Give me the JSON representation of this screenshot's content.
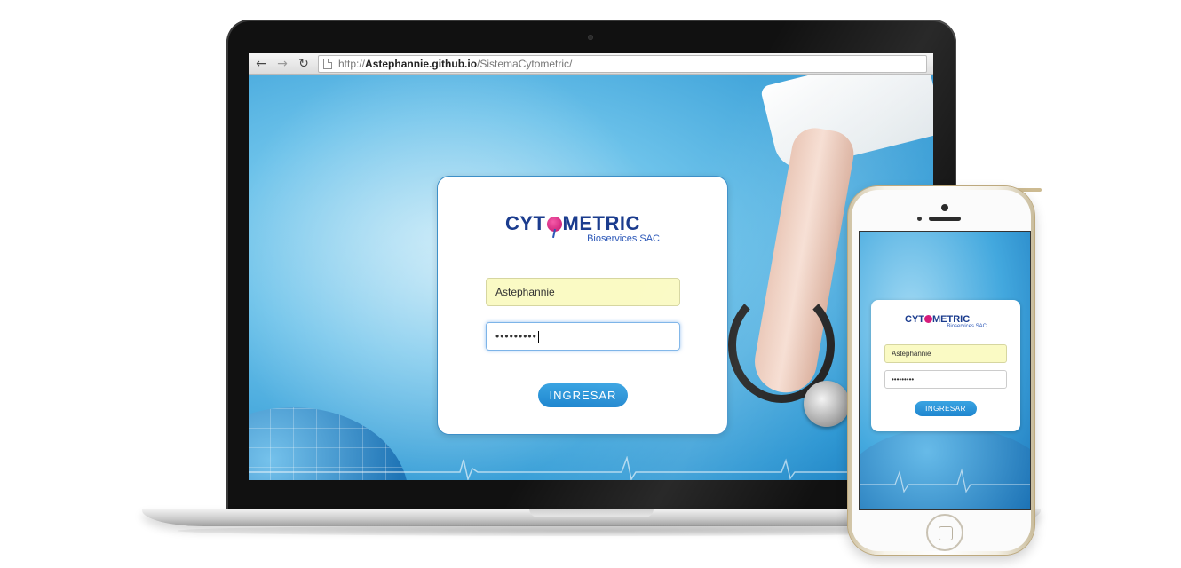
{
  "browser": {
    "back_icon": "←",
    "forward_icon": "→",
    "reload_icon": "↻",
    "url_prefix": "http://",
    "url_host": "Astephannie.github.io",
    "url_path": "/SistemaCytometric/"
  },
  "logo": {
    "main_before": "CYT",
    "main_after": "METRIC",
    "sub": "Bioservices SAC"
  },
  "login": {
    "username_value": "Astephannie",
    "password_mask": "•••••••••",
    "submit_label": "INGRESAR"
  },
  "colors": {
    "brand_blue": "#1b3c8e",
    "brand_magenta": "#d61c7b",
    "button_blue": "#1f86cf",
    "autofill_yellow": "#fafac4"
  }
}
